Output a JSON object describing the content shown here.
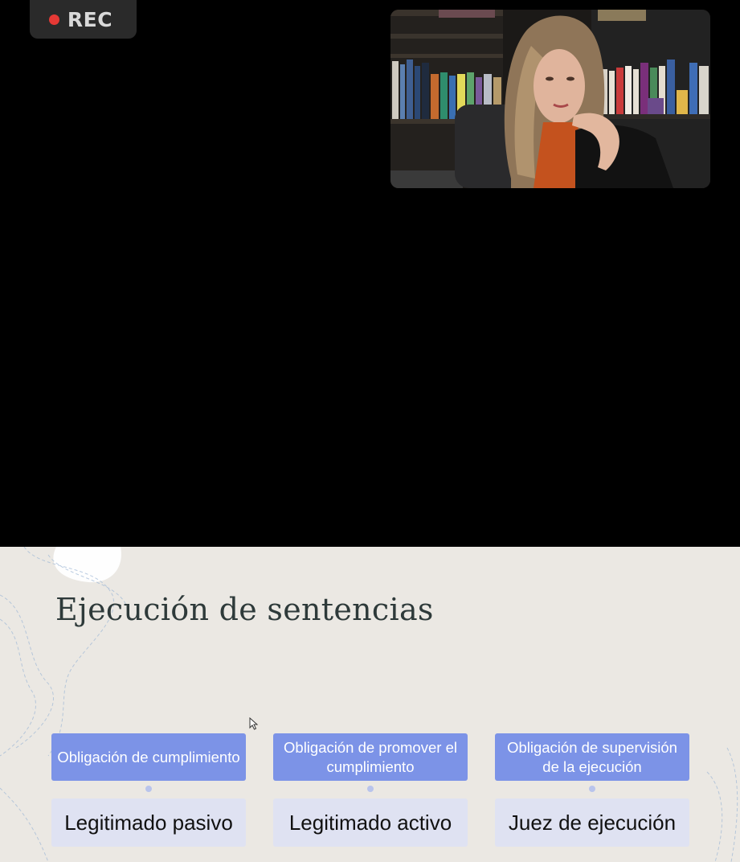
{
  "recording": {
    "label": "REC"
  },
  "slide": {
    "title": "Ejecución de sentencias",
    "columns": [
      {
        "header": "Obligación de cumplimiento",
        "body": "Legitimado pasivo"
      },
      {
        "header": "Obligación de promover el cumplimiento",
        "body": "Legitimado activo"
      },
      {
        "header": "Obligación de supervisión de la ejecución",
        "body": "Juez de ejecución"
      }
    ]
  },
  "colors": {
    "rec_dot": "#e53935",
    "slide_background": "#ebe8e3",
    "header_fill": "#7c93e7",
    "body_fill": "#dfe2f2"
  },
  "icons": [
    "recording-dot-icon",
    "mouse-pointer-icon"
  ]
}
